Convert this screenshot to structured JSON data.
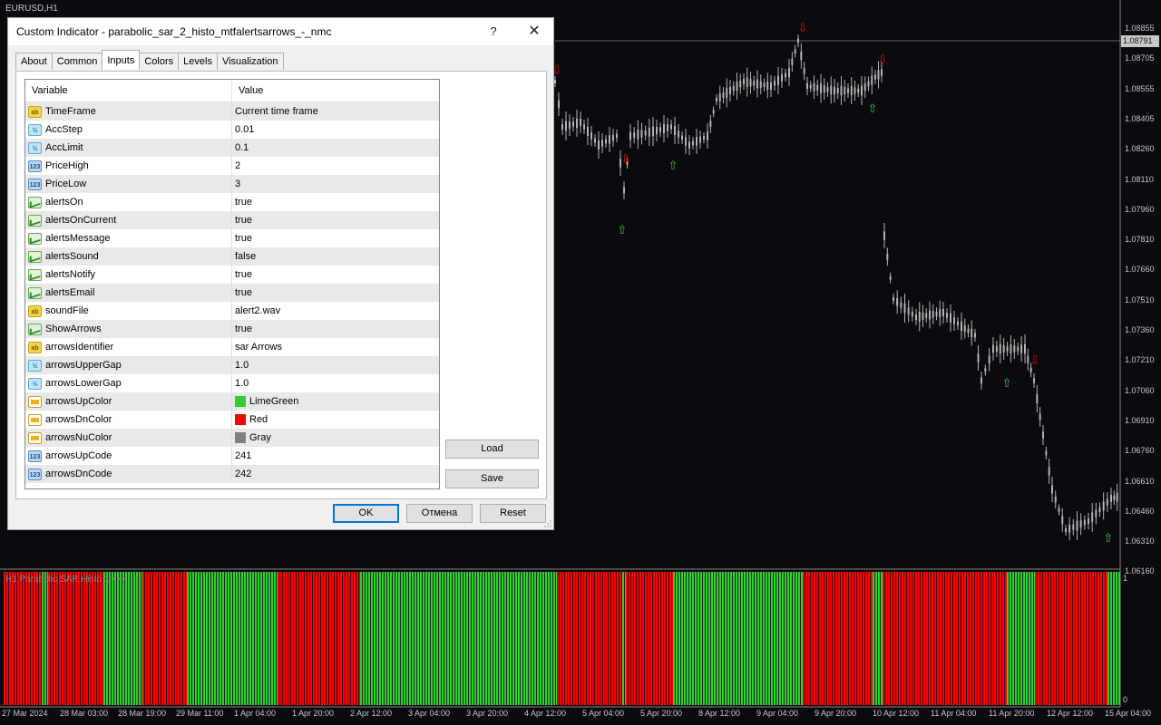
{
  "chart": {
    "symbol": "EURUSD,H1",
    "indicator_label": "H1 Parabolic SAR Histo 1 ×××",
    "current_price": "1.08791",
    "price_labels": [
      "1.08855",
      "1.08705",
      "1.08555",
      "1.08405",
      "1.08260",
      "1.08110",
      "1.07960",
      "1.07810",
      "1.07660",
      "1.07510",
      "1.07360",
      "1.07210",
      "1.07060",
      "1.06910",
      "1.06760",
      "1.06610",
      "1.06460",
      "1.06310",
      "1.06160"
    ],
    "sub_labels": [
      "1",
      "0"
    ],
    "time_labels": [
      "27 Mar 2024",
      "28 Mar 03:00",
      "28 Mar 19:00",
      "29 Mar 11:00",
      "1 Apr 04:00",
      "1 Apr 20:00",
      "2 Apr 12:00",
      "3 Apr 04:00",
      "3 Apr 20:00",
      "4 Apr 12:00",
      "5 Apr 04:00",
      "5 Apr 20:00",
      "8 Apr 12:00",
      "9 Apr 04:00",
      "9 Apr 20:00",
      "10 Apr 12:00",
      "11 Apr 04:00",
      "11 Apr 20:00",
      "12 Apr 12:00",
      "15 Apr 04:00"
    ],
    "colors": {
      "up": "#32cd32",
      "down": "#ff0000",
      "candle": "#b4b4b4",
      "background": "#0a0a0f"
    }
  },
  "dialog": {
    "title": "Custom Indicator - parabolic_sar_2_histo_mtfalertsarrows_-_nmc",
    "help": "?",
    "close": "✕",
    "tabs": [
      "About",
      "Common",
      "Inputs",
      "Colors",
      "Levels",
      "Visualization"
    ],
    "active_tab": "Inputs",
    "columns": {
      "variable": "Variable",
      "value": "Value"
    },
    "rows": [
      {
        "type": "str",
        "name": "TimeFrame",
        "value": "Current time frame"
      },
      {
        "type": "dbl",
        "name": "AccStep",
        "value": "0.01"
      },
      {
        "type": "dbl",
        "name": "AccLimit",
        "value": "0.1"
      },
      {
        "type": "int",
        "name": "PriceHigh",
        "value": "2"
      },
      {
        "type": "int",
        "name": "PriceLow",
        "value": "3"
      },
      {
        "type": "bool",
        "name": "alertsOn",
        "value": "true"
      },
      {
        "type": "bool",
        "name": "alertsOnCurrent",
        "value": "true"
      },
      {
        "type": "bool",
        "name": "alertsMessage",
        "value": "true"
      },
      {
        "type": "bool",
        "name": "alertsSound",
        "value": "false"
      },
      {
        "type": "bool",
        "name": "alertsNotify",
        "value": "true"
      },
      {
        "type": "bool",
        "name": "alertsEmail",
        "value": "true"
      },
      {
        "type": "str",
        "name": "soundFile",
        "value": "alert2.wav"
      },
      {
        "type": "bool",
        "name": "ShowArrows",
        "value": "true"
      },
      {
        "type": "str",
        "name": "arrowsIdentifier",
        "value": "sar Arrows"
      },
      {
        "type": "dbl",
        "name": "arrowsUpperGap",
        "value": "1.0"
      },
      {
        "type": "dbl",
        "name": "arrowsLowerGap",
        "value": "1.0"
      },
      {
        "type": "clr",
        "name": "arrowsUpColor",
        "value": "LimeGreen",
        "swatch": "#32cd32"
      },
      {
        "type": "clr",
        "name": "arrowsDnColor",
        "value": "Red",
        "swatch": "#ff0000"
      },
      {
        "type": "clr",
        "name": "arrowsNuColor",
        "value": "Gray",
        "swatch": "#808080"
      },
      {
        "type": "int",
        "name": "arrowsUpCode",
        "value": "241"
      },
      {
        "type": "int",
        "name": "arrowsDnCode",
        "value": "242"
      }
    ],
    "icon_glyphs": {
      "str": "ab",
      "dbl": "½",
      "int": "123"
    },
    "buttons": {
      "load": "Load",
      "save": "Save",
      "ok": "OK",
      "cancel": "Отмена",
      "reset": "Reset"
    }
  }
}
